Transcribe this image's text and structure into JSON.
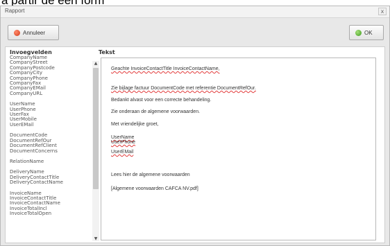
{
  "caption_fragment": "a partir de een form",
  "window": {
    "title": "Rapport",
    "close_glyph": "x"
  },
  "toolbar": {
    "cancel_label": "Annuleer",
    "ok_label": "OK"
  },
  "left": {
    "heading": "Invoegvelden",
    "groups": [
      [
        "CompanyName",
        "CompanyStreet",
        "CompanyPostcode",
        "CompanyCity",
        "CompanyPhone",
        "CompanyFax",
        "CompanyEMail",
        "CompanyURL"
      ],
      [
        "UserName",
        "UserPhone",
        "UserFax",
        "UserMobile",
        "UserEMail"
      ],
      [
        "DocumentCode",
        "DocumentRefOur",
        "DocumentRefClient",
        "DocumentConcerns"
      ],
      [
        "RelationName"
      ],
      [
        "DeliveryName",
        "DeliveryContactTitle",
        "DeliveryContactName"
      ],
      [
        "InvoiceName",
        "InvoiceContactTitle",
        "InvoiceContactName",
        "InvoiceTotalIncl",
        "InvoiceTotalOpen"
      ]
    ]
  },
  "editor": {
    "heading": "Tekst",
    "lines": [
      "Geachte InvoiceContactTitle InvoiceContactName,",
      "Zie bijlage factuur DocumentCode met referentie DocumentRefOur.",
      "Bedankt alvast voor een correcte behandeling.",
      "Zie onderaan de algemene voorwaarden.",
      "Met vriendelijke groet,",
      "UserName",
      "UserPhone",
      "UserEMail",
      "Lees hier de algemene voorwaarden",
      "[Algemene voorwaarden CAFCA NV.pdf]"
    ]
  }
}
